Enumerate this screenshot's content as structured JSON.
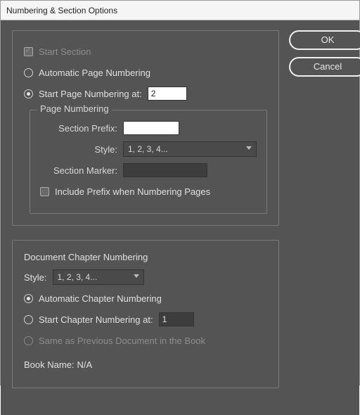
{
  "title": "Numbering & Section Options",
  "buttons": {
    "ok": "OK",
    "cancel": "Cancel"
  },
  "section": {
    "start_section": "Start Section",
    "auto_page": "Automatic Page Numbering",
    "start_page_at": "Start Page Numbering at:",
    "start_page_value": "2",
    "page_numbering_legend": "Page Numbering",
    "section_prefix": "Section Prefix:",
    "section_prefix_value": "",
    "style_label": "Style:",
    "style_value": "1, 2, 3, 4...",
    "section_marker": "Section Marker:",
    "section_marker_value": "",
    "include_prefix": "Include Prefix when Numbering Pages"
  },
  "chapter": {
    "heading": "Document Chapter Numbering",
    "style_label": "Style:",
    "style_value": "1, 2, 3, 4...",
    "auto_chapter": "Automatic Chapter Numbering",
    "start_chapter_at": "Start Chapter Numbering at:",
    "start_chapter_value": "1",
    "same_prev": "Same as Previous Document in the Book",
    "book_name_label": "Book Name:",
    "book_name_value": "N/A"
  }
}
